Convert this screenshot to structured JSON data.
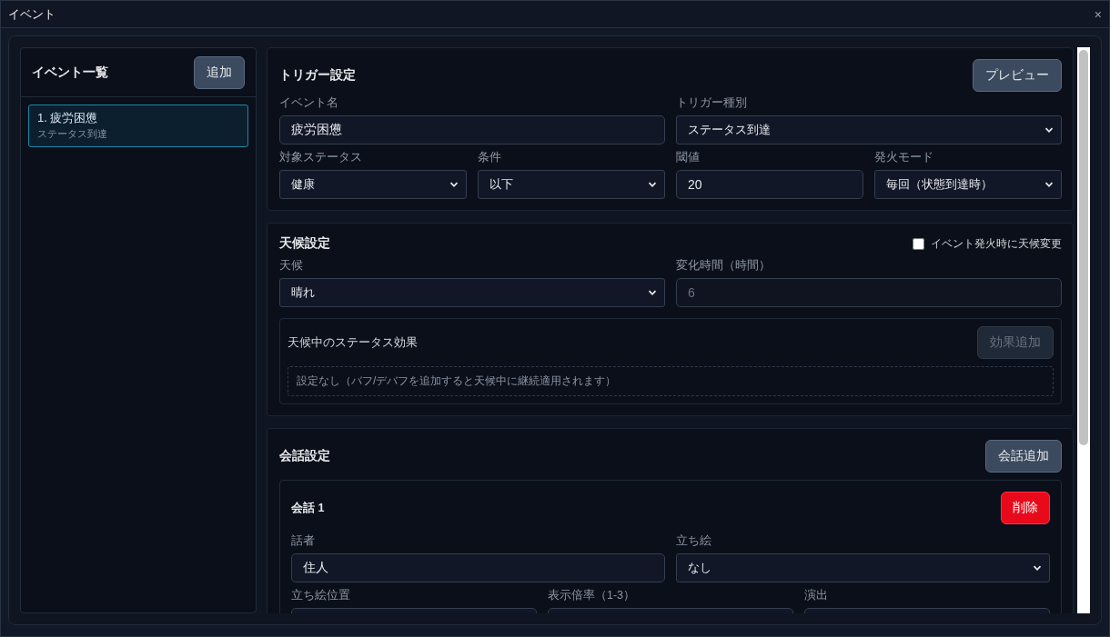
{
  "window": {
    "title": "イベント",
    "close": "×"
  },
  "event_list": {
    "title": "イベント一覧",
    "add_button": "追加",
    "items": [
      {
        "name": "1. 疲労困憊",
        "trigger": "ステータス到達",
        "selected": true
      }
    ]
  },
  "sections": [
    {
      "kind": "trigger",
      "title": "トリガー設定",
      "button": {
        "label": "プレビュー",
        "disabled": false
      },
      "field_lines": [
        {
          "fields": [
            {
              "label": "イベント名",
              "kind": "input",
              "value": "疲労困憊",
              "disabled": false
            },
            {
              "label": "トリガー種別",
              "kind": "select",
              "value": "ステータス到達",
              "disabled": false
            }
          ]
        },
        {
          "fields": [
            {
              "label": "対象ステータス",
              "kind": "select",
              "value": "健康",
              "disabled": false
            },
            {
              "label": "条件",
              "kind": "select",
              "value": "以下",
              "disabled": false
            },
            {
              "label": "閾値",
              "kind": "input",
              "value": "20",
              "disabled": false
            },
            {
              "label": "発火モード",
              "kind": "select",
              "value": "毎回（状態到達時）",
              "disabled": false
            }
          ]
        }
      ]
    },
    {
      "kind": "weather",
      "title": "天候設定",
      "checkbox": {
        "label": "イベント発火時に天候変更",
        "checked": false
      },
      "field_lines": [
        {
          "fields": [
            {
              "label": "天候",
              "kind": "select",
              "value": "晴れ",
              "disabled": false
            },
            {
              "label": "変化時間（時間）",
              "kind": "input",
              "value": "6",
              "disabled": true
            }
          ]
        }
      ],
      "subpanel": {
        "title": "天候中のステータス効果",
        "button": {
          "label": "効果追加",
          "disabled": true
        },
        "empty_text": "設定なし（バフ/デバフを追加すると天候中に継続適用されます）"
      }
    },
    {
      "kind": "dialog",
      "title": "会話設定",
      "button": {
        "label": "会話追加",
        "disabled": false
      },
      "entries": [
        {
          "title": "会話 1",
          "delete_button": "削除",
          "field_lines": [
            {
              "fields": [
                {
                  "label": "話者",
                  "kind": "input",
                  "value": "住人",
                  "disabled": false
                },
                {
                  "label": "立ち絵",
                  "kind": "select",
                  "value": "なし",
                  "disabled": false
                }
              ]
            },
            {
              "fields": [
                {
                  "label": "立ち絵位置",
                  "kind": "input"
                },
                {
                  "label": "表示倍率（1-3）",
                  "kind": "input"
                },
                {
                  "label": "演出",
                  "kind": "input"
                }
              ]
            }
          ]
        }
      ]
    }
  ]
}
